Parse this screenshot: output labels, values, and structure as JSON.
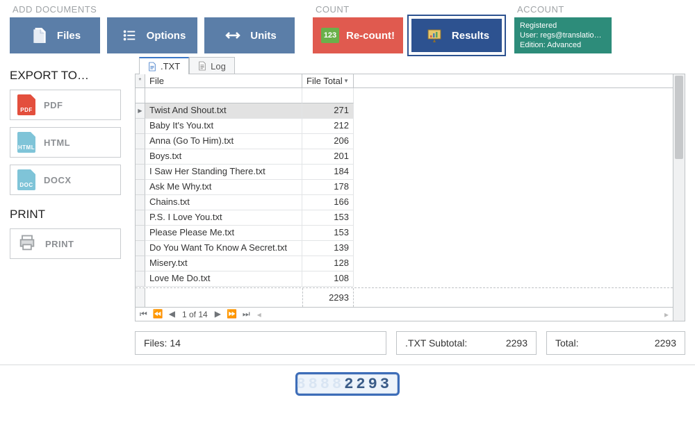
{
  "groups": {
    "add_documents": "ADD DOCUMENTS",
    "count": "COUNT",
    "account": "ACCOUNT"
  },
  "toolbar": {
    "files": "Files",
    "options": "Options",
    "units": "Units",
    "recount": "Re-count!",
    "results": "Results"
  },
  "account": {
    "line1": "Registered",
    "line2": "User: regs@translatio…",
    "line3": "Edition: Advanced"
  },
  "export": {
    "heading": "EXPORT TO…",
    "pdf": "PDF",
    "html": "HTML",
    "docx": "DOCX"
  },
  "print": {
    "heading": "PRINT",
    "label": "PRINT"
  },
  "tabs": {
    "txt": ".TXT",
    "log": "Log"
  },
  "grid": {
    "col_file": "File",
    "col_total": "File Total",
    "rows": [
      {
        "file": "Twist And Shout.txt",
        "total": "271"
      },
      {
        "file": "Baby It's You.txt",
        "total": "212"
      },
      {
        "file": "Anna (Go To Him).txt",
        "total": "206"
      },
      {
        "file": "Boys.txt",
        "total": "201"
      },
      {
        "file": "I Saw Her Standing There.txt",
        "total": "184"
      },
      {
        "file": "Ask Me Why.txt",
        "total": "178"
      },
      {
        "file": "Chains.txt",
        "total": "166"
      },
      {
        "file": "P.S. I Love You.txt",
        "total": "153"
      },
      {
        "file": "Please Please Me.txt",
        "total": "153"
      },
      {
        "file": "Do You Want To Know A Secret.txt",
        "total": "139"
      },
      {
        "file": "Misery.txt",
        "total": "128"
      },
      {
        "file": "Love Me Do.txt",
        "total": "108"
      }
    ],
    "grand_total": "2293",
    "pager": "1 of 14"
  },
  "summary": {
    "files_label": "Files:",
    "files_value": "14",
    "subtotal_label": ".TXT Subtotal:",
    "subtotal_value": "2293",
    "total_label": "Total:",
    "total_value": "2293"
  },
  "lcd": "2293"
}
